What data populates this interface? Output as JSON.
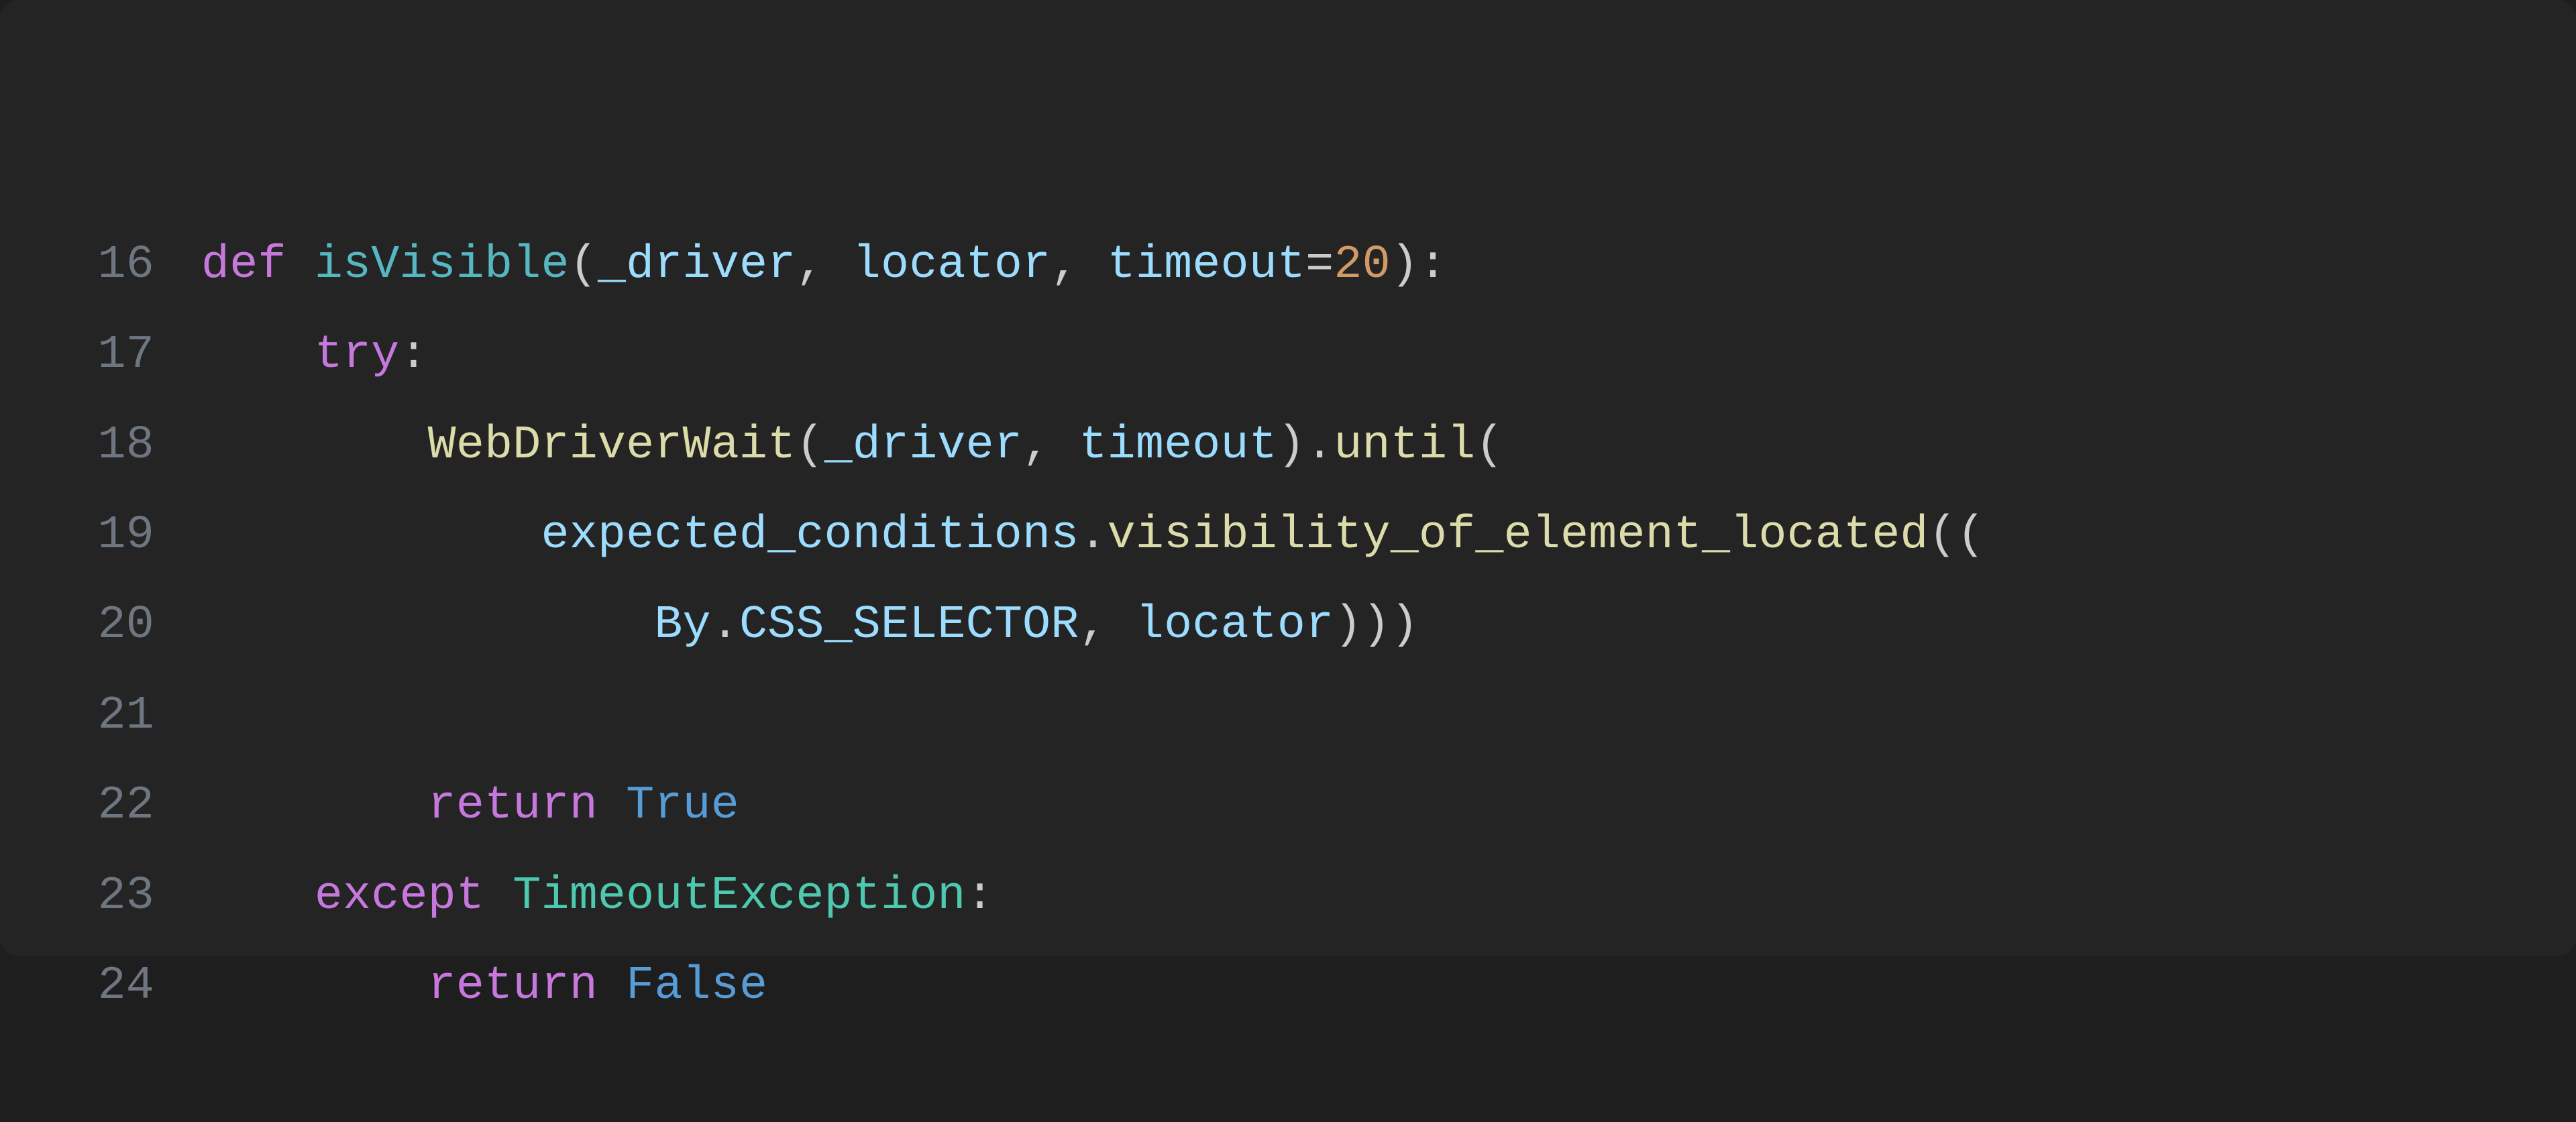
{
  "editor": {
    "language": "python",
    "lines": [
      {
        "number": "16",
        "indent": "",
        "tokens": [
          {
            "cls": "tok-kw",
            "t": "def"
          },
          {
            "cls": "tok-punc",
            "t": " "
          },
          {
            "cls": "tok-fn",
            "t": "isVisible"
          },
          {
            "cls": "tok-punc",
            "t": "("
          },
          {
            "cls": "tok-param",
            "t": "_driver"
          },
          {
            "cls": "tok-punc",
            "t": ", "
          },
          {
            "cls": "tok-param",
            "t": "locator"
          },
          {
            "cls": "tok-punc",
            "t": ", "
          },
          {
            "cls": "tok-param",
            "t": "timeout"
          },
          {
            "cls": "tok-punc",
            "t": "="
          },
          {
            "cls": "tok-num",
            "t": "20"
          },
          {
            "cls": "tok-punc",
            "t": "):"
          }
        ]
      },
      {
        "number": "17",
        "indent": "    ",
        "tokens": [
          {
            "cls": "tok-kw",
            "t": "try"
          },
          {
            "cls": "tok-punc",
            "t": ":"
          }
        ]
      },
      {
        "number": "18",
        "indent": "        ",
        "tokens": [
          {
            "cls": "tok-call",
            "t": "WebDriverWait"
          },
          {
            "cls": "tok-punc",
            "t": "("
          },
          {
            "cls": "tok-param",
            "t": "_driver"
          },
          {
            "cls": "tok-punc",
            "t": ", "
          },
          {
            "cls": "tok-param",
            "t": "timeout"
          },
          {
            "cls": "tok-punc",
            "t": ")."
          },
          {
            "cls": "tok-call",
            "t": "until"
          },
          {
            "cls": "tok-punc",
            "t": "("
          }
        ]
      },
      {
        "number": "19",
        "indent": "            ",
        "tokens": [
          {
            "cls": "tok-param",
            "t": "expected_conditions"
          },
          {
            "cls": "tok-punc",
            "t": "."
          },
          {
            "cls": "tok-call",
            "t": "visibility_of_element_located"
          },
          {
            "cls": "tok-punc",
            "t": "(("
          }
        ]
      },
      {
        "number": "20",
        "indent": "                ",
        "tokens": [
          {
            "cls": "tok-param",
            "t": "By"
          },
          {
            "cls": "tok-punc",
            "t": "."
          },
          {
            "cls": "tok-param",
            "t": "CSS_SELECTOR"
          },
          {
            "cls": "tok-punc",
            "t": ", "
          },
          {
            "cls": "tok-param",
            "t": "locator"
          },
          {
            "cls": "tok-punc",
            "t": ")))"
          }
        ]
      },
      {
        "number": "21",
        "indent": "",
        "tokens": []
      },
      {
        "number": "22",
        "indent": "        ",
        "tokens": [
          {
            "cls": "tok-kw",
            "t": "return"
          },
          {
            "cls": "tok-punc",
            "t": " "
          },
          {
            "cls": "tok-const",
            "t": "True"
          }
        ]
      },
      {
        "number": "23",
        "indent": "    ",
        "tokens": [
          {
            "cls": "tok-kw",
            "t": "except"
          },
          {
            "cls": "tok-punc",
            "t": " "
          },
          {
            "cls": "tok-type",
            "t": "TimeoutException"
          },
          {
            "cls": "tok-punc",
            "t": ":"
          }
        ]
      },
      {
        "number": "24",
        "indent": "        ",
        "tokens": [
          {
            "cls": "tok-kw",
            "t": "return"
          },
          {
            "cls": "tok-punc",
            "t": " "
          },
          {
            "cls": "tok-const",
            "t": "False"
          }
        ]
      }
    ]
  }
}
